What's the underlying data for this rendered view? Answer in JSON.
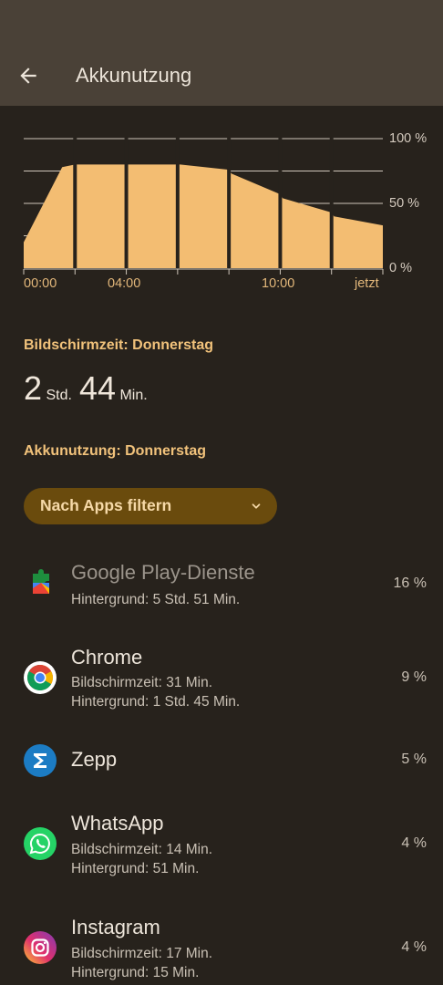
{
  "appbar": {
    "title": "Akkunutzung"
  },
  "chart_data": {
    "type": "area",
    "y_ticks": [
      "100 %",
      "50 %",
      "0 %"
    ],
    "x_ticks": [
      "00:00",
      "04:00",
      "10:00",
      "jetzt"
    ],
    "ylim": [
      0,
      100
    ],
    "x_hours": [
      0,
      1.5,
      2,
      4,
      4.1,
      6,
      6.1,
      8,
      8.1,
      10,
      10.1,
      12,
      12.1,
      14
    ],
    "values": [
      20,
      78,
      80,
      80,
      80,
      80,
      80,
      76,
      73,
      57,
      54,
      43,
      40,
      33
    ],
    "fill_color": "#f3bd72",
    "grid": true
  },
  "screen_time": {
    "label": "Bildschirmzeit: Donnerstag",
    "hours": "2",
    "hours_unit": "Std.",
    "minutes": "44",
    "minutes_unit": "Min."
  },
  "battery_usage_label": "Akkunutzung: Donnerstag",
  "filter": {
    "label": "Nach Apps filtern"
  },
  "apps": [
    {
      "name": "Google Play-Dienste",
      "line1": "Hintergrund: 5 Std. 51 Min.",
      "line2": "",
      "percent": "16 %",
      "icon": "google-play-services-icon"
    },
    {
      "name": "Chrome",
      "line1": "Bildschirmzeit: 31 Min.",
      "line2": "Hintergrund: 1 Std. 45 Min.",
      "percent": "9 %",
      "icon": "chrome-icon"
    },
    {
      "name": "Zepp",
      "line1": "",
      "line2": "",
      "percent": "5 %",
      "icon": "zepp-icon"
    },
    {
      "name": "WhatsApp",
      "line1": "Bildschirmzeit: 14 Min.",
      "line2": "Hintergrund: 51 Min.",
      "percent": "4 %",
      "icon": "whatsapp-icon"
    },
    {
      "name": "Instagram",
      "line1": "Bildschirmzeit: 17 Min.",
      "line2": "Hintergrund: 15 Min.",
      "percent": "4 %",
      "icon": "instagram-icon"
    }
  ]
}
